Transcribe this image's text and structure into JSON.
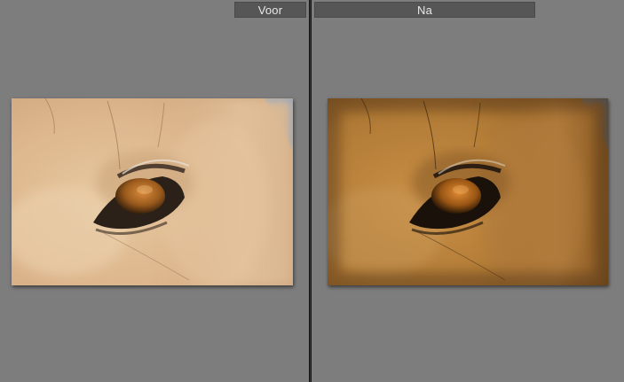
{
  "compare": {
    "before_label": "Voor",
    "after_label": "Na"
  },
  "colors": {
    "before_fur": "#dcb58c",
    "before_fur_light": "#ecd3b0",
    "before_sky": "#6c9fd8",
    "after_fur": "#b8803a",
    "after_fur_dark": "#5e3a14",
    "after_sky": "#2a6fb6",
    "iris": "#b06a22"
  },
  "icons": {
    "before_photo": "horse-eye-photo",
    "after_photo": "horse-eye-photo-edited"
  }
}
